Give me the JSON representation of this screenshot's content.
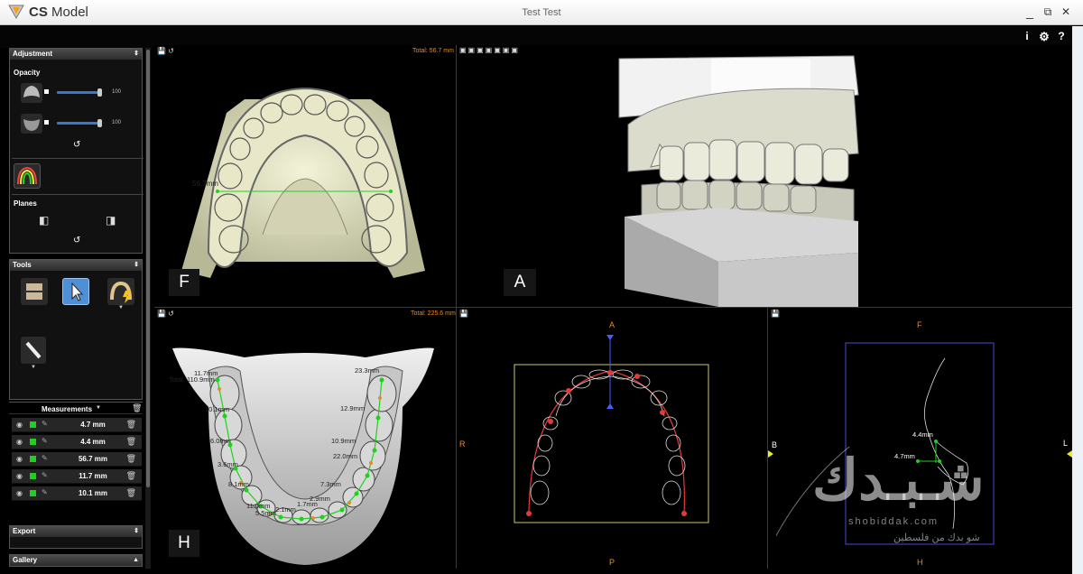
{
  "titlebar": {
    "app_name_bold": "CS",
    "app_name_rest": "Model",
    "window_title": "Test Test",
    "minimize": "_",
    "maximize": "⧉",
    "close": "✕"
  },
  "topbar": {
    "info": "i",
    "settings": "⚙",
    "help": "?"
  },
  "adjustment": {
    "header": "Adjustment",
    "opacity_label": "Opacity",
    "upper_value": "100",
    "lower_value": "100",
    "upper_opacity": 1.0,
    "lower_opacity": 1.0,
    "planes_label": "Planes"
  },
  "tools": {
    "header": "Tools"
  },
  "measurements": {
    "header": "Measurements",
    "rows": [
      {
        "value": "4.7 mm"
      },
      {
        "value": "4.4 mm"
      },
      {
        "value": "56.7 mm"
      },
      {
        "value": "11.7 mm"
      },
      {
        "value": "10.1 mm"
      }
    ]
  },
  "export": {
    "header": "Export"
  },
  "gallery": {
    "header": "Gallery"
  },
  "viewports": {
    "front": {
      "letter": "F",
      "total": "Total: 56.7 mm",
      "label": "56.7mm"
    },
    "anterior": {
      "letter": "A"
    },
    "hori": {
      "letter": "H",
      "total": "Total: 225.6 mm",
      "labels": [
        "11.7mm",
        "Total: 110.9mm",
        "10.1mm",
        "6.0mm",
        "3.6mm",
        "8.1mm",
        "11.0mm",
        "5.5mm",
        "2.1mm",
        "1.7mm",
        "2.9mm",
        "7.3mm",
        "22.0mm",
        "10.9mm",
        "12.9mm",
        "23.3mm"
      ]
    },
    "occlusal_top": {
      "top": "A",
      "bottom": "P",
      "left": "R"
    },
    "profile": {
      "top": "F",
      "bottom": "H",
      "left": "B",
      "left_axis": "L",
      "right_axis": "L",
      "m1": "4.4mm",
      "m2": "4.7mm"
    }
  },
  "watermark": {
    "word": "شـبـدك",
    "site": "shobiddak.com",
    "arabic": "شو بدك من فلسطين"
  },
  "colors": {
    "accent_orange": "#e58c2a",
    "measure_green": "#1fd11f",
    "selected_tool": "#4f8fd6"
  }
}
